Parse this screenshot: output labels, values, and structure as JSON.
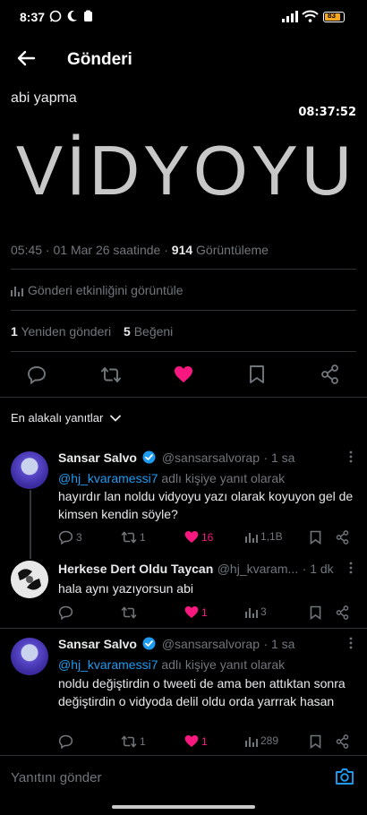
{
  "status_bar": {
    "time": "8:37",
    "battery": "83"
  },
  "header": {
    "title": "Gönderi"
  },
  "post": {
    "text": "abi yapma",
    "video_overlay_time": "08:37:52",
    "video_caption": "VİDYOYU",
    "meta_time_date": "05:45 · 01 Mar 26 saatinde · ",
    "views_count": "914",
    "views_label": " Görüntüleme",
    "activity_label": "Gönderi etkinliğini görüntüle",
    "reposts_count": "1",
    "reposts_label": "Yeniden gönderi",
    "likes_count": "5",
    "likes_label": "Beğeni"
  },
  "sort": {
    "label": "En alakalı yanıtlar"
  },
  "replies": [
    {
      "name": "Sansar Salvo",
      "verified": true,
      "handle": "@sansarsalvorap",
      "time": "· 1 sa",
      "reply_to_handle": "@hj_kvaramessi7",
      "reply_to_suffix": " adlı kişiye yanıt olarak",
      "text": "hayırdır lan noldu vidyoyu yazı olarak koyuyon gel de kimsen kendin söyle?",
      "comments": "3",
      "reposts": "1",
      "likes": "16",
      "views": "1,1B"
    },
    {
      "name": "Herkese Dert Oldu Taycan",
      "handle": "@hj_kvaram...",
      "time": "· 1 dk",
      "text": "hala aynı yazıyorsun abi",
      "comments": "",
      "reposts": "",
      "likes": "1",
      "views": "3"
    },
    {
      "name": "Sansar Salvo",
      "verified": true,
      "handle": "@sansarsalvorap",
      "time": "· 1 sa",
      "reply_to_handle": "@hj_kvaramessi7",
      "reply_to_suffix": " adlı kişiye yanıt olarak",
      "text": "noldu değiştirdin o tweeti de ama ben attıktan sonra değiştirdin o vidyoda delil oldu orda yarrrak hasan",
      "comments": "",
      "reposts": "1",
      "likes": "1",
      "views": "289"
    }
  ],
  "composer": {
    "placeholder": "Yanıtını gönder"
  },
  "colors": {
    "accent": "#1d9bf0",
    "like": "#f91880",
    "verified": "#1d9bf0",
    "battery": "#f5a623"
  }
}
